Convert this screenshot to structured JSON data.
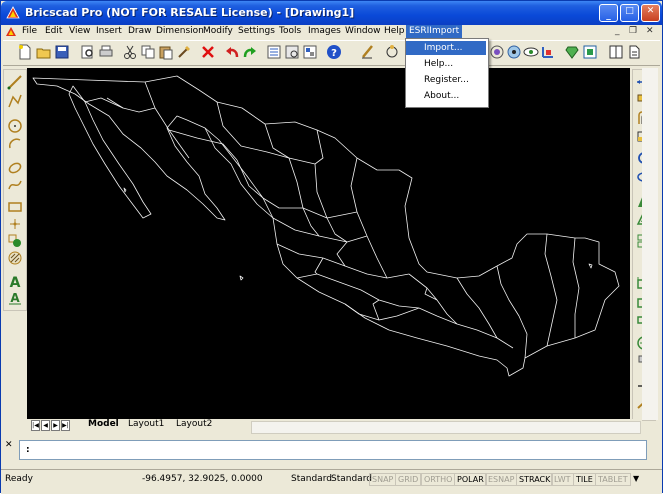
{
  "window": {
    "title": "Bricscad Pro (NOT FOR RESALE License) - [Drawing1]",
    "accent": "#0a49d8"
  },
  "menu": {
    "items": [
      "File",
      "Edit",
      "View",
      "Insert",
      "Draw",
      "Dimension",
      "Modify",
      "Settings",
      "Tools",
      "Images",
      "Window",
      "Help",
      "ESRIImport"
    ],
    "active": "ESRIImport",
    "dropdown": [
      "Import...",
      "Help...",
      "Register...",
      "About..."
    ],
    "highlighted": "Import..."
  },
  "toolbar": {
    "icons": [
      "new-icon",
      "open-icon",
      "save-icon",
      "print-preview-icon",
      "print-icon",
      "cut-icon",
      "copy-icon",
      "paste-icon",
      "match-properties-icon",
      "delete-icon",
      "undo-icon",
      "redo-icon",
      "properties-icon",
      "design-center-icon",
      "explorer-icon",
      "help-icon",
      "draw-icon",
      "orbit-icon",
      "render-icon",
      "visibility-icon",
      "layer-icon",
      "hatch-icon",
      "block-icon",
      "insert-icon",
      "tile-icon",
      "new-layout-icon"
    ]
  },
  "left_toolbar": {
    "icons": [
      "line-icon",
      "polyline-icon",
      "circle-icon",
      "arc-icon",
      "ellipse-icon",
      "spline-icon",
      "rectangle-icon",
      "point-icon",
      "block-icon",
      "hatch-icon",
      "text-icon",
      "mtext-icon"
    ]
  },
  "right_toolbar": {
    "icons": [
      "move-icon",
      "copy-icon",
      "offset-icon",
      "scale-icon",
      "rotate-icon",
      "mirror-icon",
      "stretch-icon",
      "array-icon",
      "trim-icon",
      "extend-icon",
      "break-icon",
      "chamfer-icon",
      "fillet-icon",
      "explode-icon",
      "lengthen-icon",
      "divide-icon"
    ]
  },
  "tabs": {
    "items": [
      "Model",
      "Layout1",
      "Layout2"
    ],
    "active": "Model"
  },
  "command": {
    "prompt": ":"
  },
  "status": {
    "state": "Ready",
    "coordinates": "-96.4957, 32.9025, 0.0000",
    "style1": "Standard",
    "style2": "Standard",
    "toggles": [
      {
        "label": "SNAP",
        "on": false
      },
      {
        "label": "GRID",
        "on": false
      },
      {
        "label": "ORTHO",
        "on": false
      },
      {
        "label": "POLAR",
        "on": true
      },
      {
        "label": "ESNAP",
        "on": false
      },
      {
        "label": "STRACK",
        "on": true
      },
      {
        "label": "LWT",
        "on": false
      },
      {
        "label": "TILE",
        "on": true
      },
      {
        "label": "TABLET",
        "on": false
      }
    ]
  }
}
